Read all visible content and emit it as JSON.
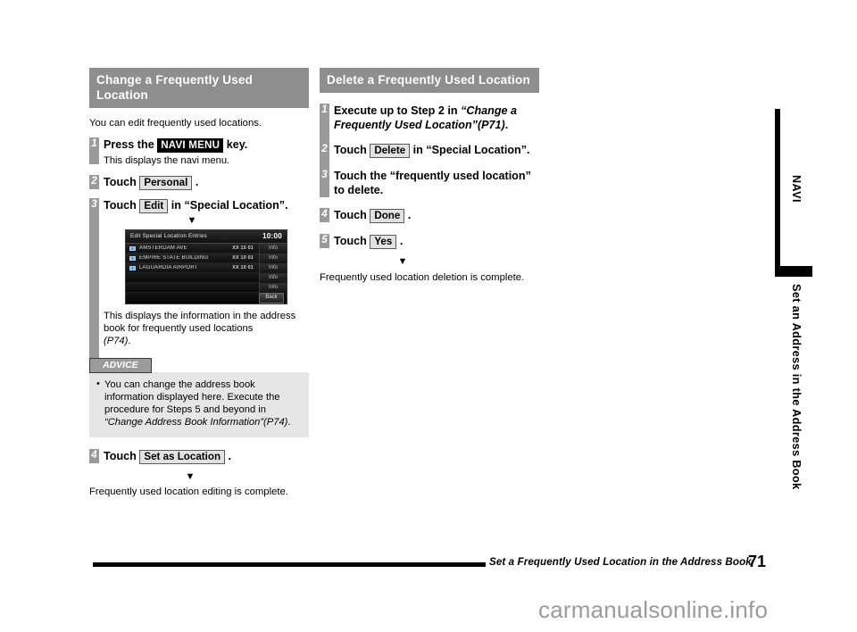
{
  "left_column": {
    "heading": "Change a Frequently Used Location",
    "intro": "You can edit frequently used locations.",
    "steps": [
      {
        "number": "1",
        "title_prefix": "Press the ",
        "key_label": "NAVI MENU",
        "title_suffix": " key.",
        "sub": "This displays the navi menu."
      },
      {
        "number": "2",
        "title_prefix": "Touch ",
        "key_label": "Personal",
        "title_suffix": " ."
      },
      {
        "number": "3",
        "title_prefix": "Touch ",
        "key_label": "Edit",
        "title_suffix": " in “Special Location”."
      },
      {
        "number": "4",
        "title_prefix": "Touch ",
        "key_label": "Set as Location",
        "title_suffix": " ."
      }
    ],
    "arrow_glyph": "▼",
    "navi_screen": {
      "title": "Edit Special Location Entries",
      "clock": "10:00",
      "info_label": "Info",
      "back_label": "Back",
      "entries": [
        {
          "name": "AMSTERDAM AVE",
          "date": "XX 10 01"
        },
        {
          "name": "EMPIRE STATE BUILDING",
          "date": "XX 10 01"
        },
        {
          "name": "LAGUARDIA AIRPORT",
          "date": "XX 10 01"
        }
      ],
      "empty_rows": 2
    },
    "caption_line1": "This displays the information in the",
    "caption_line2": "address book for frequently used locations",
    "caption_ref": "(P74)",
    "caption_end": ".",
    "advice": {
      "badge": "ADVICE",
      "text_a": "You can change the address book information displayed here.",
      "text_b": "Execute the procedure for Steps 5 and beyond in ",
      "text_italic": "“Change Address Book Information”(P74)",
      "text_end": "."
    },
    "closing": "Frequently used location editing is complete."
  },
  "right_column": {
    "heading": "Delete a Frequently Used Location",
    "steps": [
      {
        "number": "1",
        "title_prefix": "Execute up to Step 2 in ",
        "title_italic": "“Change a Frequently Used Location”(P71)",
        "title_suffix": "."
      },
      {
        "number": "2",
        "title_prefix": "Touch ",
        "key_label": "Delete",
        "title_suffix": " in “Special Location”."
      },
      {
        "number": "3",
        "title_plain": "Touch the “frequently used location” to delete."
      },
      {
        "number": "4",
        "title_prefix": "Touch ",
        "key_label": "Done",
        "title_suffix": " ."
      },
      {
        "number": "5",
        "title_prefix": "Touch ",
        "key_label": "Yes",
        "title_suffix": " ."
      }
    ],
    "arrow_glyph": "▼",
    "closing": "Frequently used location deletion is complete."
  },
  "side_tab": {
    "section_label": "NAVI",
    "chapter_label": "Set an Address in the Address Book"
  },
  "footer": {
    "title": "Set a Frequently Used Location in the Address Book",
    "page_number": "71"
  },
  "watermark": "carmanualsonline.info",
  "colors": {
    "heading_bar": "#8e8e8e",
    "step_marker": "#9a9a9a",
    "advice_badge": "#9b9b9b",
    "advice_body": "#e6e6e6",
    "key_black": "#000000",
    "key_gray": "#e2e2e2"
  }
}
